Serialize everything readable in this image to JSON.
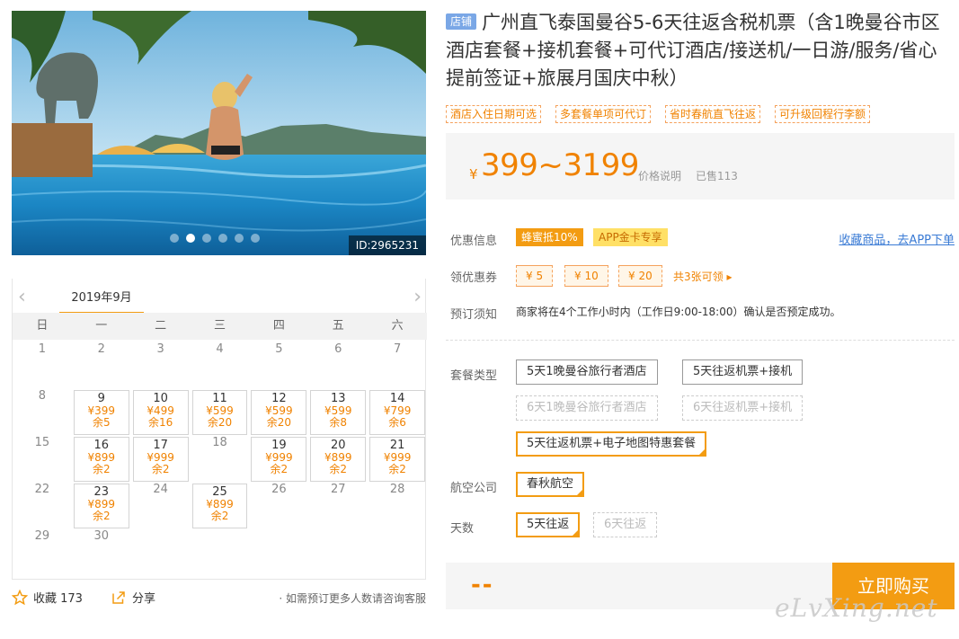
{
  "hero": {
    "id_label": "ID:2965231",
    "dot_count": 6,
    "active_dot": 1
  },
  "calendar": {
    "prev": "‹",
    "next": "›",
    "month": "2019年9月",
    "weekdays": [
      "日",
      "一",
      "二",
      "三",
      "四",
      "五",
      "六"
    ],
    "rows": [
      [
        {
          "d": "1"
        },
        {
          "d": "2"
        },
        {
          "d": "3"
        },
        {
          "d": "4"
        },
        {
          "d": "5"
        },
        {
          "d": "6"
        },
        {
          "d": "7"
        }
      ],
      [
        {
          "d": "8"
        },
        {
          "d": "9",
          "p": "¥399",
          "l": "余5"
        },
        {
          "d": "10",
          "p": "¥499",
          "l": "余16"
        },
        {
          "d": "11",
          "p": "¥599",
          "l": "余20"
        },
        {
          "d": "12",
          "p": "¥599",
          "l": "余20"
        },
        {
          "d": "13",
          "p": "¥599",
          "l": "余8"
        },
        {
          "d": "14",
          "p": "¥799",
          "l": "余6"
        }
      ],
      [
        {
          "d": "15"
        },
        {
          "d": "16",
          "p": "¥899",
          "l": "余2"
        },
        {
          "d": "17",
          "p": "¥999",
          "l": "余2"
        },
        {
          "d": "18"
        },
        {
          "d": "19",
          "p": "¥999",
          "l": "余2"
        },
        {
          "d": "20",
          "p": "¥899",
          "l": "余2"
        },
        {
          "d": "21",
          "p": "¥999",
          "l": "余2"
        }
      ],
      [
        {
          "d": "22"
        },
        {
          "d": "23",
          "p": "¥899",
          "l": "余2"
        },
        {
          "d": "24"
        },
        {
          "d": "25",
          "p": "¥899",
          "l": "余2"
        },
        {
          "d": "26"
        },
        {
          "d": "27"
        },
        {
          "d": "28"
        }
      ],
      [
        {
          "d": "29"
        },
        {
          "d": "30"
        }
      ]
    ]
  },
  "actions": {
    "fav_label": "收藏 173",
    "share_label": "分享",
    "note": "· 如需预订更多人数请咨询客服"
  },
  "product": {
    "shop_badge": "店铺",
    "title": "广州直飞泰国曼谷5-6天往返含税机票（含1晚曼谷市区酒店套餐+接机套餐+可代订酒店/接送机/一日游/服务/省心提前签证+旅展月国庆中秋）",
    "tags": [
      "酒店入住日期可选",
      "多套餐单项可代订",
      "省时春航直飞往返",
      "可升级回程行李额"
    ]
  },
  "price": {
    "currency": "¥",
    "range": "399~3199",
    "desc": "价格说明",
    "sold": "已售113"
  },
  "promo": {
    "label": "优惠信息",
    "badge_a": "蜂蜜抵10%",
    "badge_b": "APP金卡专享",
    "fav_link": "收藏商品，去APP下单"
  },
  "coupons": {
    "label": "领优惠券",
    "items": [
      "¥ 5",
      "¥ 10",
      "¥ 20"
    ],
    "more": "共3张可领 ▸"
  },
  "booking": {
    "label": "预订须知",
    "notice": "商家将在4个工作小时内（工作日9:00-18:00）确认是否预定成功。"
  },
  "package": {
    "label": "套餐类型",
    "opt1": "5天1晚曼谷旅行者酒店",
    "opt2": "5天往返机票+接机",
    "opt3": "6天1晚曼谷旅行者酒店",
    "opt4": "6天往返机票+接机",
    "opt5": "5天往返机票+电子地图特惠套餐"
  },
  "airline": {
    "label": "航空公司",
    "opt1": "春秋航空"
  },
  "days": {
    "label": "天数",
    "opt1": "5天往返",
    "opt2": "6天往返"
  },
  "buy": {
    "total": "--",
    "button": "立即购买"
  },
  "watermark": "eLvXing.net",
  "colors": {
    "accent": "#f39c12",
    "price": "#f08200",
    "link": "#3a7bd5"
  }
}
